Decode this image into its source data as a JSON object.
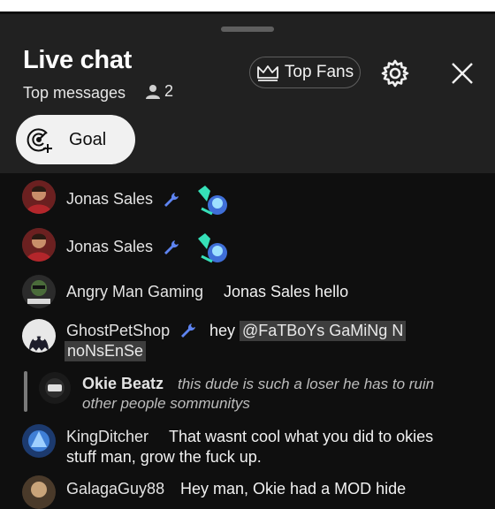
{
  "header": {
    "title": "Live chat",
    "mode": "Top messages",
    "viewer_count": "2",
    "top_fans_label": "Top Fans",
    "goal_label": "Goal"
  },
  "messages": [
    {
      "author": "Jonas Sales",
      "text": "",
      "sticker": "waving-sticker",
      "moderator": true
    },
    {
      "author": "Jonas Sales",
      "text": "",
      "sticker": "waving-sticker",
      "moderator": true
    },
    {
      "author": "Angry Man Gaming",
      "text": "Jonas Sales hello",
      "moderator": false
    },
    {
      "author": "GhostPetShop",
      "text": "hey",
      "mention_line1": "@FaTBoYs GaMiNg N",
      "mention_line2": "noNsEnSe",
      "moderator": true
    },
    {
      "author": "Okie Beatz",
      "quoted_line1": "this dude is such a loser he has to ruin",
      "quoted_line2": "other people sommunitys",
      "reply": true
    },
    {
      "author": "KingDitcher",
      "text_line1": "That wasnt cool what you did to okies",
      "text_line2": "stuff man, grow the fuck up."
    },
    {
      "author": "GalagaGuy88",
      "text": "Hey man, Okie had a MOD hide"
    }
  ],
  "colors": {
    "background": "#0f0f0f",
    "panel": "#212121",
    "moderator_icon": "#5e84f1"
  }
}
